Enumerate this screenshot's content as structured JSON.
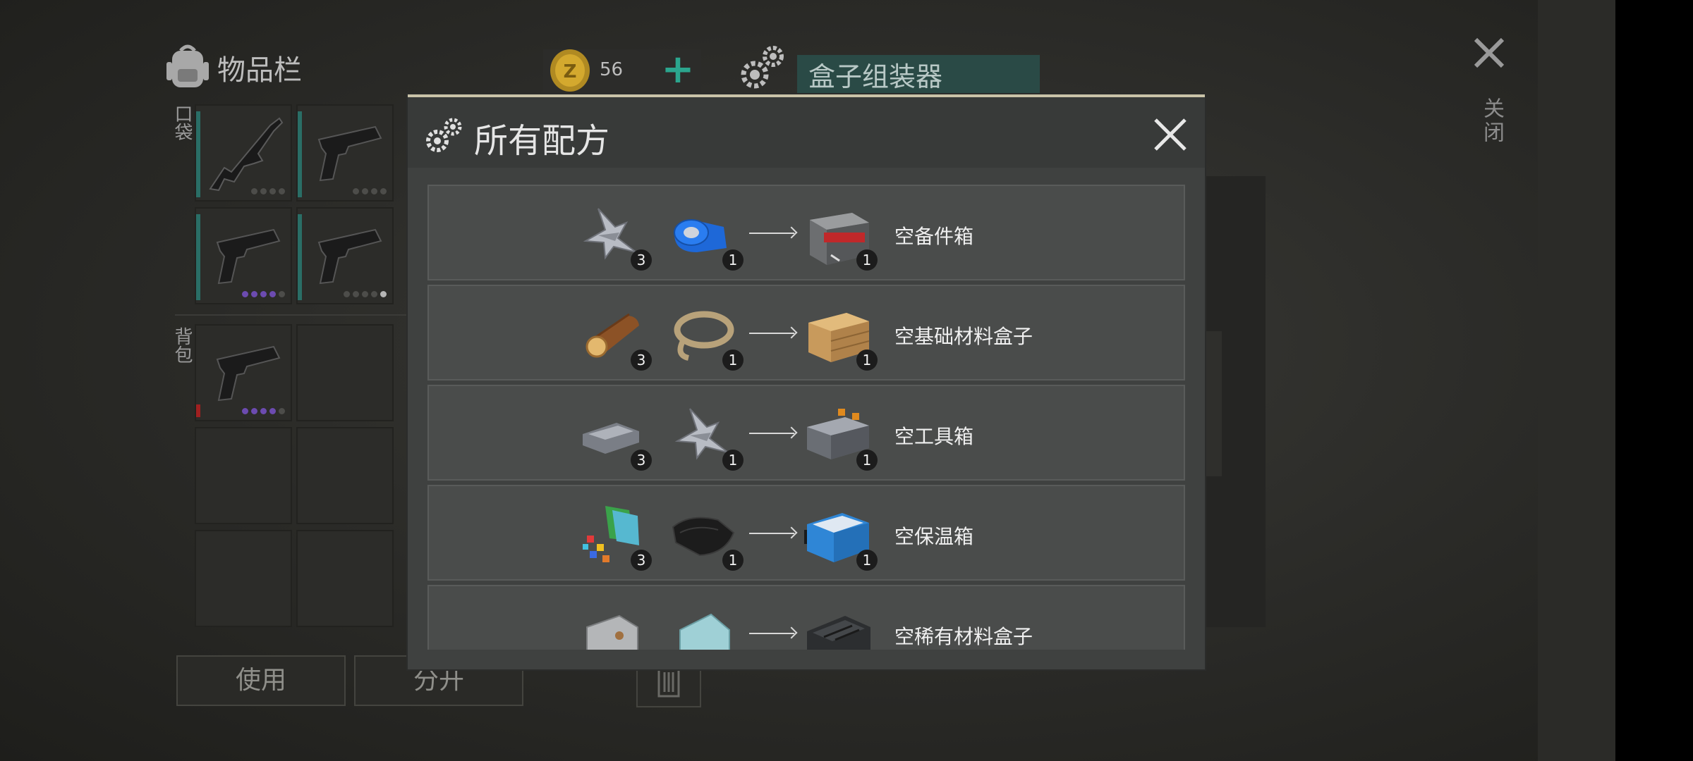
{
  "inventory": {
    "title": "物品栏",
    "pocket_label": "口袋",
    "backpack_label": "背包",
    "coins": "56",
    "plus_symbol": "+"
  },
  "crafting": {
    "station_name": "盒子组装器"
  },
  "close": {
    "symbol": "✕",
    "label": "关闭"
  },
  "buttons": {
    "use": "使用",
    "split": "分开"
  },
  "modal": {
    "title": "所有配方",
    "close_symbol": "✕"
  },
  "recipes": [
    {
      "ingredient1": "scrap-metal",
      "qty1": "3",
      "ingredient2": "duct-tape",
      "qty2": "1",
      "result": "spare-parts-box",
      "result_qty": "1",
      "name": "空备件箱"
    },
    {
      "ingredient1": "log",
      "qty1": "3",
      "ingredient2": "rope",
      "qty2": "1",
      "result": "wooden-crate",
      "result_qty": "1",
      "name": "空基础材料盒子"
    },
    {
      "ingredient1": "iron-ingot",
      "qty1": "3",
      "ingredient2": "scrap-metal",
      "qty2": "1",
      "result": "toolbox",
      "result_qty": "1",
      "name": "空工具箱"
    },
    {
      "ingredient1": "cloth-scraps",
      "qty1": "3",
      "ingredient2": "leather",
      "qty2": "1",
      "result": "cooler-box",
      "result_qty": "1",
      "name": "空保温箱"
    },
    {
      "ingredient1": "steel-plate",
      "qty1": "",
      "ingredient2": "glass-plate",
      "qty2": "",
      "result": "rare-materials-box",
      "result_qty": "",
      "name": "空稀有材料盒子"
    }
  ],
  "colors": {
    "accent_teal": "#2ba68e",
    "modal_border": "#c9c3a8",
    "rarity_purple": "#6c4bb0"
  }
}
